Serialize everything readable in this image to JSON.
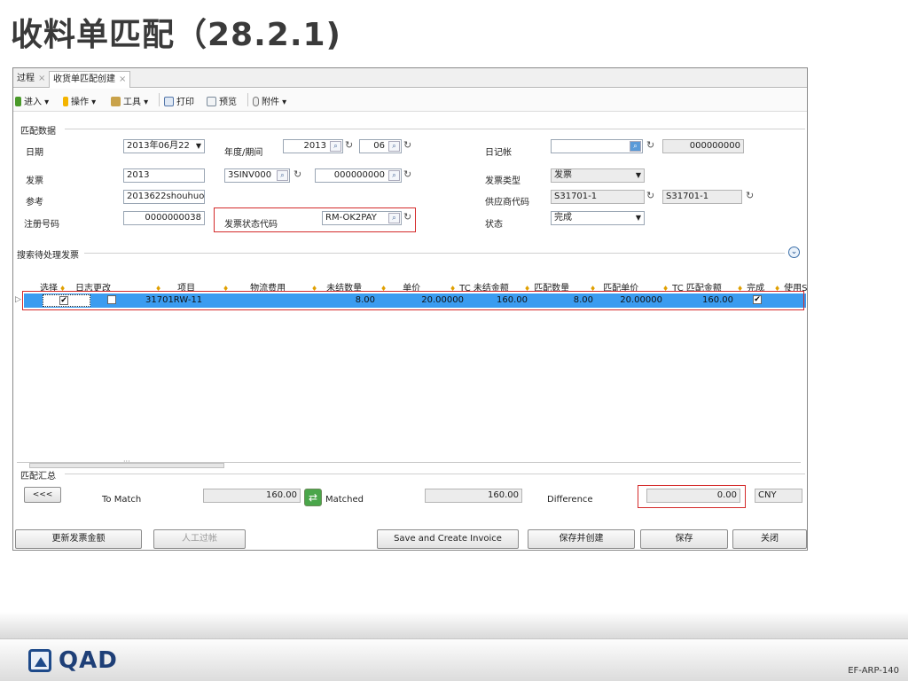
{
  "slide": {
    "title": "收料单匹配（28.2.1)",
    "code": "EF-ARP-140",
    "logo_text": "QAD"
  },
  "window": {
    "tabs": [
      {
        "label": "过程",
        "close": "×"
      },
      {
        "label": "收货单匹配创建",
        "close": "×"
      }
    ],
    "toolbar": {
      "enter": "进入 ▾",
      "operate": "操作 ▾",
      "tools": "工具 ▾",
      "print": "打印",
      "preview": "预览",
      "attach": "附件 ▾"
    }
  },
  "match_data": {
    "group_label": "匹配数据",
    "date_label": "日期",
    "date_value": "2013年06月22",
    "period_label": "年度/期间",
    "year_value": "2013",
    "period_value": "06",
    "journal_label": "日记帐",
    "journal_value": "",
    "journal_number": "000000000",
    "invoice_label": "发票",
    "invoice_value": "2013",
    "invoice_series": "3SINV000",
    "invoice_number": "000000000",
    "invoice_type_label": "发票类型",
    "invoice_type_value": "发票",
    "reference_label": "参考",
    "reference_value": "2013622shouhuo",
    "supplier_code_label": "供应商代码",
    "supplier_code_value": "S31701-1",
    "supplier_code_value2": "S31701-1",
    "registration_label": "注册号码",
    "registration_value": "0000000038",
    "invoice_status_label": "发票状态代码",
    "invoice_status_value": "RM-OK2PAY",
    "status_label": "状态",
    "status_value": "完成"
  },
  "search": {
    "label": "搜索待处理发票",
    "expand_icon": "⌄"
  },
  "grid": {
    "headers": [
      "选择",
      "日志更改",
      "项目",
      "物流费用",
      "未结数量",
      "单价",
      "TC 未结金额",
      "匹配数量",
      "匹配单价",
      "TC 匹配金额",
      "完成",
      "使用S"
    ],
    "row": {
      "select": "✔",
      "log_change": "",
      "item": "31701RW-11",
      "logistics": "",
      "open_qty": "8.00",
      "unit_price": "20.00000",
      "tc_open_amount": "160.00",
      "match_qty": "8.00",
      "match_unit_price": "20.00000",
      "tc_match_amount": "160.00",
      "complete": "✔"
    },
    "scroll_mark": "···"
  },
  "summary": {
    "group_label": "匹配汇总",
    "back_button": "<<<",
    "to_match_label": "To Match",
    "to_match_value": "160.00",
    "matched_label": "Matched",
    "matched_value": "160.00",
    "difference_label": "Difference",
    "difference_value": "0.00",
    "currency": "CNY"
  },
  "buttons": {
    "update_invoice": "更新发票金额",
    "manual_post": "人工过帐",
    "save_create_invoice": "Save and Create Invoice",
    "save_and_create": "保存并创建",
    "save": "保存",
    "close": "关闭"
  },
  "colors": {
    "row_highlight": "#3b9cf0",
    "annotation_red": "#d42a2a",
    "logo_blue": "#1e3f77"
  }
}
